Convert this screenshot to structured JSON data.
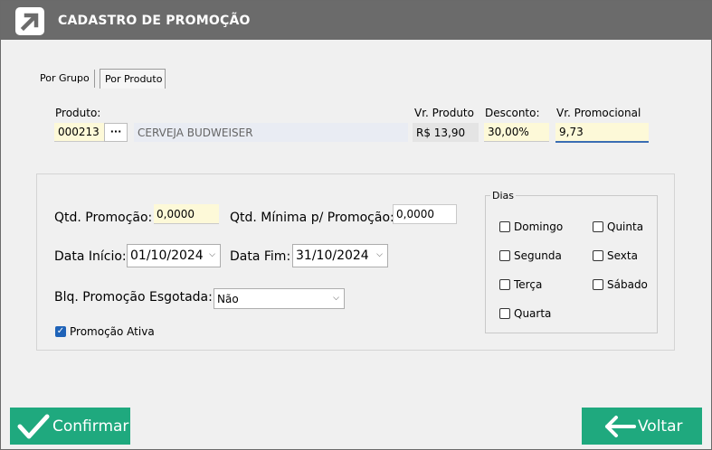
{
  "window": {
    "title": "CADASTRO DE PROMOÇÃO"
  },
  "tabs": [
    {
      "label": "Por Grupo"
    },
    {
      "label": "Por Produto"
    }
  ],
  "produto": {
    "label": "Produto:",
    "code": "000213",
    "lookup_button": "···",
    "description": "CERVEJA BUDWEISER",
    "vr_produto_label": "Vr. Produto",
    "vr_produto": "R$ 13,90",
    "desconto_label": "Desconto:",
    "desconto": "30,00%",
    "vr_promocional_label": "Vr. Promocional",
    "vr_promocional": "9,73"
  },
  "form": {
    "qtd_promocao_label": "Qtd. Promoção:",
    "qtd_promocao": "0,0000",
    "qtd_minima_label": "Qtd. Mínima p/ Promoção:",
    "qtd_minima": "0,0000",
    "data_inicio_label": "Data Início:",
    "data_inicio": "01/10/2024",
    "data_fim_label": "Data Fim:",
    "data_fim": "31/10/2024",
    "blq_label": "Blq. Promoção Esgotada:",
    "blq_value": "Não",
    "promocao_ativa_label": "Promoção Ativa",
    "promocao_ativa": true
  },
  "dias": {
    "title": "Dias",
    "items": [
      {
        "label": "Domingo",
        "checked": false
      },
      {
        "label": "Quinta",
        "checked": false
      },
      {
        "label": "Segunda",
        "checked": false
      },
      {
        "label": "Sexta",
        "checked": false
      },
      {
        "label": "Terça",
        "checked": false
      },
      {
        "label": "Sábado",
        "checked": false
      },
      {
        "label": "Quarta",
        "checked": false
      }
    ]
  },
  "buttons": {
    "confirmar": "Confirmar",
    "voltar": "Voltar"
  },
  "colors": {
    "titlebar": "#6b6b6b",
    "button": "#1fa97e",
    "highlight_input": "#fdf9d8",
    "accent": "#1f63b8"
  }
}
